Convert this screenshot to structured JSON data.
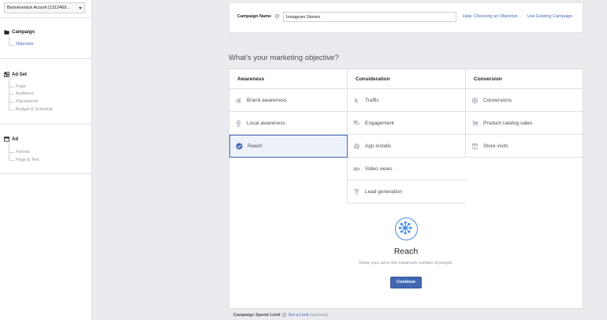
{
  "sidebar": {
    "account_select": "Bannersnack Acount (1312469...",
    "sections": [
      {
        "title": "Campaign",
        "items": [
          "Objective"
        ]
      },
      {
        "title": "Ad Set",
        "items": [
          "Page",
          "Audience",
          "Placements",
          "Budget & Schedule"
        ]
      },
      {
        "title": "Ad",
        "items": [
          "Format",
          "Page & Text"
        ]
      }
    ]
  },
  "top_bar": {
    "campaign_name_label": "Campaign Name",
    "campaign_name_value": "Instagram Stories",
    "help_link": "Help: Choosing an Objective",
    "existing_link": "Use Existing Campaign"
  },
  "objective": {
    "title": "What's your marketing objective?",
    "columns": [
      {
        "header": "Awareness",
        "items": [
          {
            "label": "Brand awareness",
            "icon": "megaphone-icon"
          },
          {
            "label": "Local awareness",
            "icon": "location-pin-icon"
          },
          {
            "label": "Reach",
            "icon": "checkmark-circle-icon",
            "selected": true
          }
        ]
      },
      {
        "header": "Consideration",
        "items": [
          {
            "label": "Traffic",
            "icon": "cursor-icon"
          },
          {
            "label": "Engagement",
            "icon": "chat-bubbles-icon"
          },
          {
            "label": "App installs",
            "icon": "box-icon"
          },
          {
            "label": "Video views",
            "icon": "video-camera-icon"
          },
          {
            "label": "Lead generation",
            "icon": "funnel-icon"
          }
        ]
      },
      {
        "header": "Conversion",
        "items": [
          {
            "label": "Conversions",
            "icon": "globe-icon"
          },
          {
            "label": "Product catalog sales",
            "icon": "shopping-cart-icon"
          },
          {
            "label": "Store visits",
            "icon": "store-icon"
          }
        ]
      }
    ],
    "detail": {
      "title": "Reach",
      "description": "Show your ad to the maximum number of people.",
      "button": "Continue"
    }
  },
  "spend": {
    "label": "Campaign Spend Limit",
    "link": "Set a Limit",
    "optional": "(optional)"
  },
  "colors": {
    "accent": "#4267b2",
    "icon_blue": "#4a90e2",
    "background": "#e9ebee"
  }
}
